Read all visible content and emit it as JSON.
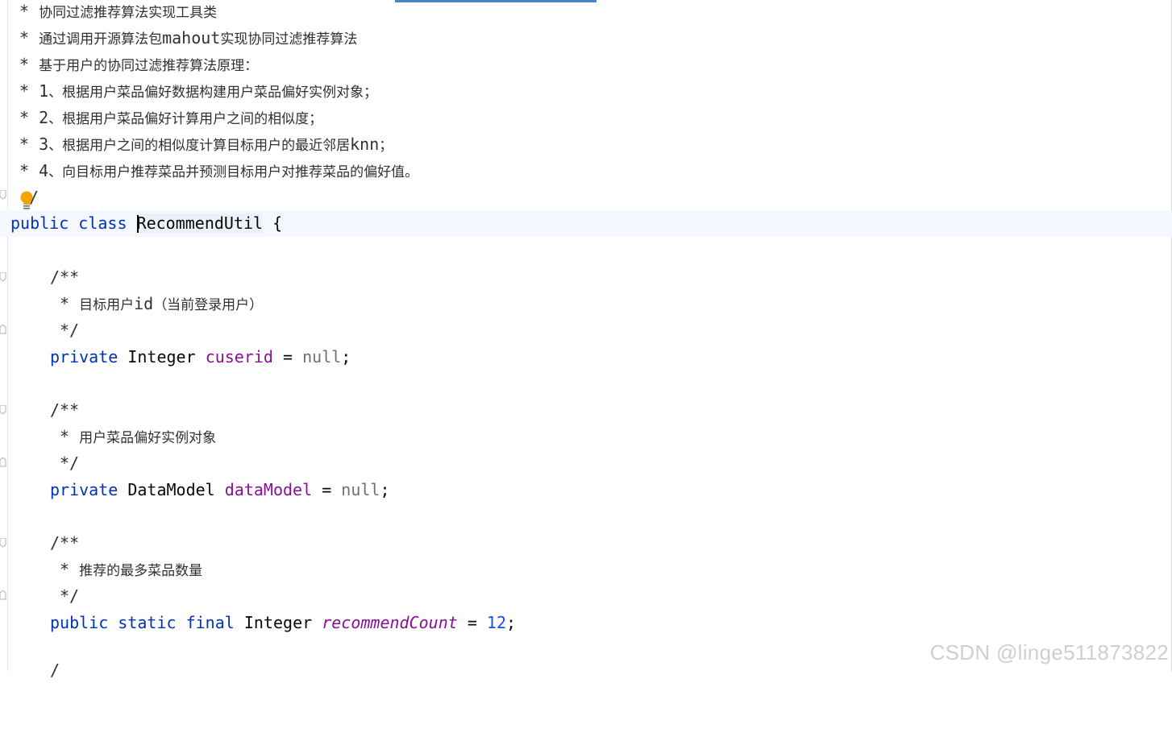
{
  "doc_comment": {
    "star": "*",
    "line1": "协同过滤推荐算法实现工具类",
    "line2_a": "通过调用开源算法包",
    "line2_b": "mahout",
    "line2_c": "实现协同过滤推荐算法",
    "line3": "基于用户的协同过滤推荐算法原理：",
    "line4_num": "1",
    "line4": "、根据用户菜品偏好数据构建用户菜品偏好实例对象；",
    "line5_num": "2",
    "line5": "、根据用户菜品偏好计算用户之间的相似度；",
    "line6_num": "3",
    "line6_a": "、根据用户之间的相似度计算目标用户的最近邻居",
    "line6_b": "knn",
    "line6_c": "；",
    "line7_num": "4",
    "line7": "、向目标用户推荐菜品并预测目标用户对推荐菜品的偏好值。",
    "close": "/"
  },
  "class_decl": {
    "modifier": "public",
    "keyword": "class",
    "name": "RecommendUtil",
    "brace": "{"
  },
  "field1": {
    "comment_open": "/**",
    "comment_star": "*",
    "comment_a": "目标用户",
    "comment_b": "id",
    "comment_c": "（当前登录用户）",
    "comment_close": "*/",
    "modifier": "private",
    "type": "Integer",
    "name": "cuserid",
    "eq": "=",
    "value": "null",
    "semi": ";"
  },
  "field2": {
    "comment_open": "/**",
    "comment_star": "*",
    "comment": "用户菜品偏好实例对象",
    "comment_close": "*/",
    "modifier": "private",
    "type": "DataModel",
    "name": "dataModel",
    "eq": "=",
    "value": "null",
    "semi": ";"
  },
  "field3": {
    "comment_open": "/**",
    "comment_star": "*",
    "comment": "推荐的最多菜品数量",
    "comment_close": "*/",
    "modifier1": "public",
    "modifier2": "static",
    "modifier3": "final",
    "type": "Integer",
    "name": "recommendCount",
    "eq": "=",
    "value": "12",
    "semi": ";"
  },
  "partial_next": "/",
  "watermark": "CSDN @linge511873822",
  "colors": {
    "keyword": "#0033b3",
    "field": "#871094",
    "null": "#707070",
    "number": "#1750eb",
    "current_line": "#f5f8fe",
    "bulb": "#f4a300"
  },
  "icons": [
    "intention-bulb-icon",
    "fold-marker-icon"
  ]
}
